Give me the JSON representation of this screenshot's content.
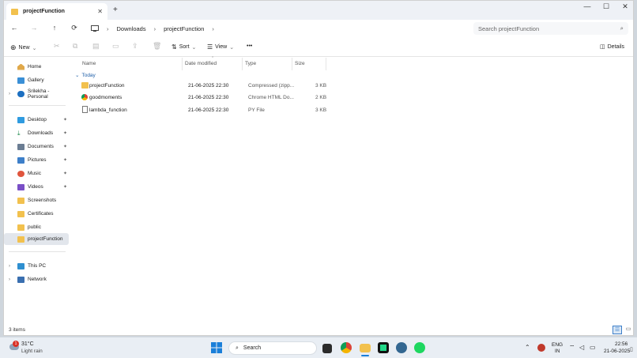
{
  "window": {
    "tab_title": "projectFunction",
    "tab_close": "✕",
    "new_tab": "+",
    "controls": {
      "minimize": "—",
      "maximize": "☐",
      "close": "✕"
    }
  },
  "nav": {
    "back": "←",
    "forward": "→",
    "up": "↑",
    "refresh": "⟳",
    "breadcrumb": [
      "Downloads",
      "projectFunction"
    ],
    "search_placeholder": "Search projectFunction"
  },
  "toolbar": {
    "new_label": "New",
    "sort_label": "Sort",
    "view_label": "View",
    "more": "•••",
    "details_label": "Details"
  },
  "sidebar": {
    "top": [
      {
        "label": "Home",
        "icon": "home-icon"
      },
      {
        "label": "Gallery",
        "icon": "gallery-icon"
      },
      {
        "label": "Srilekha - Personal",
        "icon": "onedrive-icon"
      }
    ],
    "pinned": [
      {
        "label": "Desktop",
        "icon": "desktop-icon",
        "pinned": true
      },
      {
        "label": "Downloads",
        "icon": "downloads-icon",
        "pinned": true
      },
      {
        "label": "Documents",
        "icon": "documents-icon",
        "pinned": true
      },
      {
        "label": "Pictures",
        "icon": "pictures-icon",
        "pinned": true
      },
      {
        "label": "Music",
        "icon": "music-icon",
        "pinned": true
      },
      {
        "label": "Videos",
        "icon": "videos-icon",
        "pinned": true
      },
      {
        "label": "Screenshots",
        "icon": "folder-icon"
      },
      {
        "label": "Certificates",
        "icon": "folder-icon"
      },
      {
        "label": "public",
        "icon": "folder-icon"
      },
      {
        "label": "projectFunction",
        "icon": "folder-icon",
        "selected": true
      }
    ],
    "bottom": [
      {
        "label": "This PC",
        "icon": "pc-icon"
      },
      {
        "label": "Network",
        "icon": "network-icon"
      }
    ]
  },
  "columns": {
    "name": "Name",
    "date": "Date modified",
    "type": "Type",
    "size": "Size"
  },
  "group_label": "Today",
  "files": [
    {
      "name": "projectFunction",
      "date": "21-06-2025 22:30",
      "type": "Compressed (zipp...",
      "size": "3 KB",
      "icon": "zip-folder-icon"
    },
    {
      "name": "goodmoments",
      "date": "21-06-2025 22:30",
      "type": "Chrome HTML Do...",
      "size": "2 KB",
      "icon": "chrome-html-icon"
    },
    {
      "name": "lambda_function",
      "date": "21-06-2025 22:30",
      "type": "PY File",
      "size": "3 KB",
      "icon": "py-file-icon"
    }
  ],
  "status": {
    "item_count": "3 items"
  },
  "taskbar": {
    "weather_temp": "31°C",
    "weather_desc": "Light rain",
    "weather_badge": "1",
    "search_label": "Search",
    "lang": "ENG",
    "region": "IN",
    "time": "22:56",
    "date": "21-06-2025"
  },
  "colors": {
    "accent": "#1f5fa8",
    "folder": "#f2c14e",
    "selected": "#e2e6ec"
  }
}
